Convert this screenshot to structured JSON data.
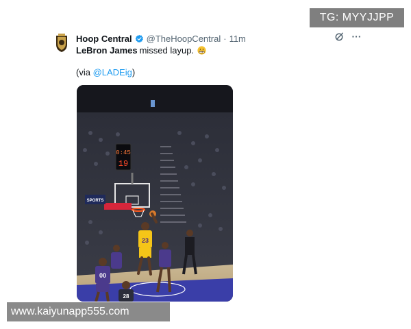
{
  "tweet": {
    "author_name": "Hoop Central",
    "author_handle": "@TheHoopCentral",
    "separator": "·",
    "time": "11m",
    "text_bold": "LeBron James",
    "text_rest": "missed layup.",
    "emoji_name": "grimacing-face",
    "via_prefix": "(via ",
    "via_mention": "@LADEig",
    "via_suffix": ")",
    "verified_color": "#1d9bf0"
  },
  "media": {
    "shot_clock": "0:45",
    "shot_clock_seconds": "19",
    "arena_sign": "SPORTS",
    "jersey_lebron": "23",
    "jersey_defender": "00",
    "jersey_referee": "28"
  },
  "actions": {
    "grok_icon": "grok-icon",
    "more_icon": "more-dots-icon",
    "more_glyph": "···"
  },
  "watermarks": {
    "top_right": "TG: MYYJJPP",
    "bottom_left": "www.kaiyunapp555.com"
  },
  "colors": {
    "link": "#1d9bf0",
    "muted": "#536471",
    "lakers_gold": "#f5c518",
    "suns_purple": "#4b3a8c"
  }
}
